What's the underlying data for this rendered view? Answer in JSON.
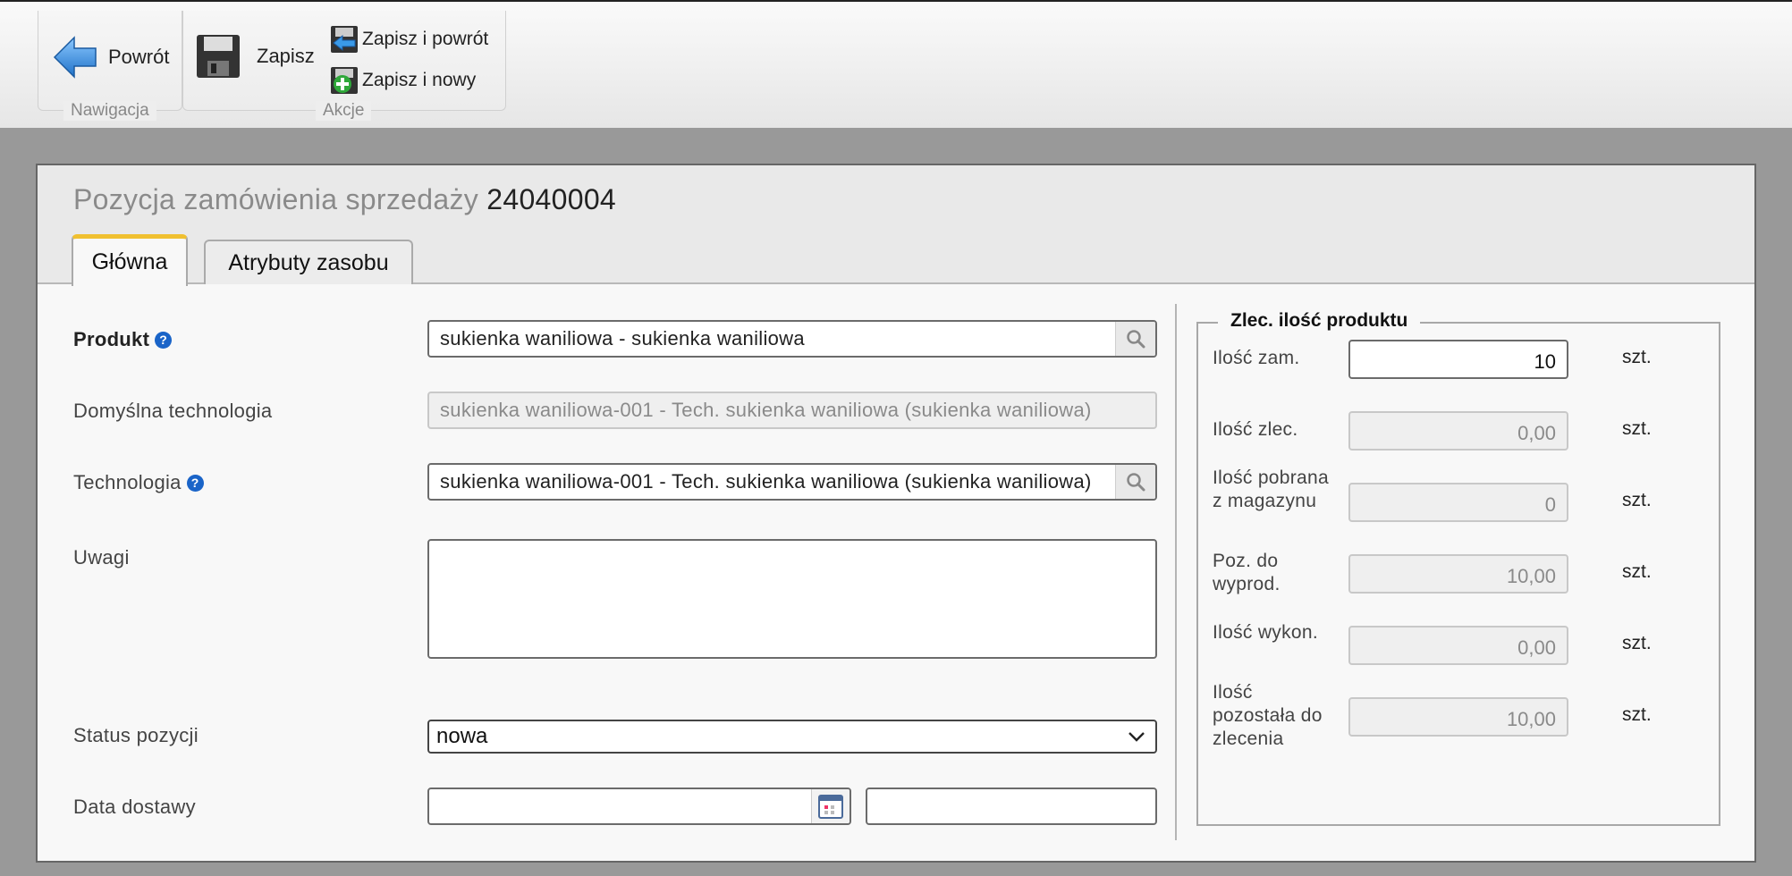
{
  "toolbar": {
    "back_label": "Powrót",
    "save_label": "Zapisz",
    "save_back_label": "Zapisz i powrót",
    "save_new_label": "Zapisz i nowy",
    "group_nav": "Nawigacja",
    "group_actions": "Akcje"
  },
  "header": {
    "title": "Pozycja zamówienia sprzedaży",
    "number": "24040004"
  },
  "tabs": [
    {
      "label": "Główna",
      "active": true
    },
    {
      "label": "Atrybuty zasobu",
      "active": false
    }
  ],
  "form": {
    "product_label": "Produkt",
    "product_value": "sukienka waniliowa - sukienka waniliowa",
    "default_tech_label": "Domyślna technologia",
    "default_tech_value": "sukienka waniliowa-001 - Tech. sukienka waniliowa (sukienka waniliowa)",
    "tech_label": "Technologia",
    "tech_value": "sukienka waniliowa-001 - Tech. sukienka waniliowa (sukienka waniliowa)",
    "notes_label": "Uwagi",
    "notes_value": "",
    "status_label": "Status pozycji",
    "status_value": "nowa",
    "delivery_label": "Data dostawy",
    "delivery_date": "",
    "delivery_time": ""
  },
  "quantities": {
    "legend": "Zlec. ilość produktu",
    "unit": "szt.",
    "rows": [
      {
        "label": "Ilość zam.",
        "value": "10",
        "editable": true
      },
      {
        "label": "Ilość zlec.",
        "value": "0,00",
        "editable": false
      },
      {
        "label": "Ilość pobrana z magazynu",
        "value": "0",
        "editable": false
      },
      {
        "label": "Poz. do wyprod.",
        "value": "10,00",
        "editable": false
      },
      {
        "label": "Ilość wykon.",
        "value": "0,00",
        "editable": false
      },
      {
        "label": "Ilość pozostała do zlecenia",
        "value": "10,00",
        "editable": false
      }
    ]
  },
  "colors": {
    "tab_accent": "#f0c030",
    "help_icon": "#1a64c8",
    "back_arrow": "#2e8de0"
  }
}
